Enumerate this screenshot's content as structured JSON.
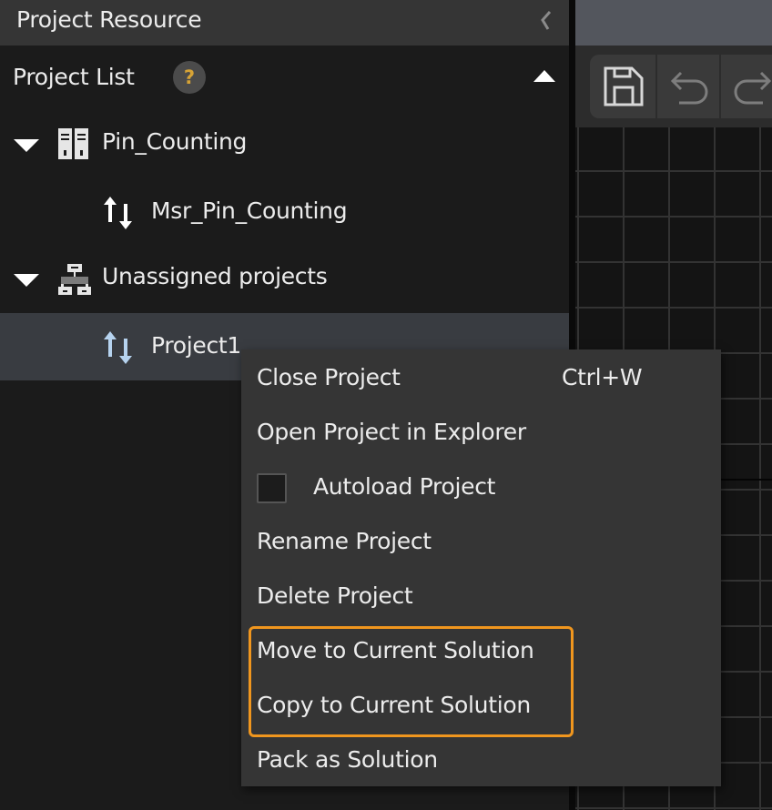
{
  "panel": {
    "title": "Project Resource",
    "collapse_icon": "chevron-left-icon"
  },
  "section": {
    "title": "Project List",
    "help_glyph": "?",
    "toggle_icon": "eject-triangle-icon"
  },
  "tree": [
    {
      "label": "Pin_Counting",
      "type": "solution",
      "icon": "solution-icon",
      "expanded": true,
      "selected": false
    },
    {
      "label": "Msr_Pin_Counting",
      "type": "project",
      "icon": "up-down-arrows-icon",
      "selected": false
    },
    {
      "label": "Unassigned projects",
      "type": "group",
      "icon": "hierarchy-icon",
      "expanded": true,
      "selected": false
    },
    {
      "label": "Project1",
      "type": "project",
      "icon": "up-down-arrows-icon",
      "selected": true
    }
  ],
  "toolbar": {
    "buttons": [
      {
        "name": "save",
        "icon": "save-icon"
      },
      {
        "name": "undo",
        "icon": "undo-icon"
      },
      {
        "name": "redo",
        "icon": "redo-icon"
      }
    ]
  },
  "context_menu": {
    "items": [
      {
        "label": "Close Project",
        "shortcut": "Ctrl+W"
      },
      {
        "label": "Open Project in Explorer"
      },
      {
        "label": "Autoload Project",
        "checkbox": true,
        "checked": false
      },
      {
        "label": "Rename Project"
      },
      {
        "label": "Delete Project"
      },
      {
        "label": "Move to Current Solution",
        "highlighted": true
      },
      {
        "label": "Copy to Current Solution",
        "highlighted": true
      },
      {
        "label": "Pack as Solution"
      }
    ]
  },
  "colors": {
    "highlight": "#f0961e",
    "help_glyph": "#d6a336",
    "selected_row": "#393c41",
    "menu_bg": "#353535"
  }
}
